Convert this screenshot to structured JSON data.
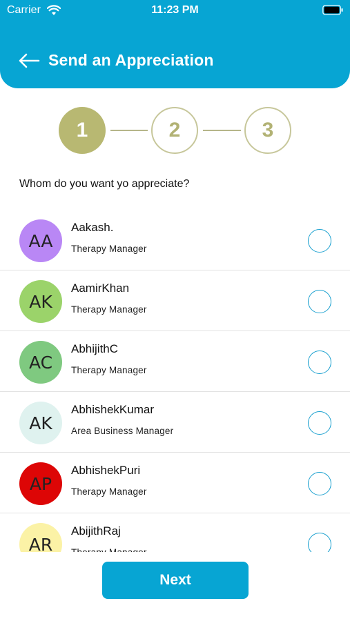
{
  "status_bar": {
    "carrier": "Carrier",
    "time": "11:23 PM"
  },
  "header": {
    "title": "Send an Appreciation",
    "background_color": "#07a5d3"
  },
  "stepper": {
    "steps": [
      "1",
      "2",
      "3"
    ],
    "active_step": 1,
    "active_color": "#b8b872"
  },
  "question": "Whom do you want yo appreciate?",
  "people": [
    {
      "initials": "AA",
      "name": "Aakash.",
      "role": "Therapy Manager",
      "avatar_color": "#b987f5"
    },
    {
      "initials": "AK",
      "name": "AamirKhan",
      "role": "Therapy Manager",
      "avatar_color": "#9bd36a"
    },
    {
      "initials": "AC",
      "name": "AbhijithC",
      "role": "Therapy Manager",
      "avatar_color": "#7fc980"
    },
    {
      "initials": "AK",
      "name": "AbhishekKumar",
      "role": "Area Business Manager",
      "avatar_color": "#dff2ef"
    },
    {
      "initials": "AP",
      "name": "AbhishekPuri",
      "role": "Therapy Manager",
      "avatar_color": "#dd0606"
    },
    {
      "initials": "AR",
      "name": "AbijithRaj",
      "role": "Therapy Manager",
      "avatar_color": "#fbf2a6"
    }
  ],
  "next_button": {
    "label": "Next"
  }
}
